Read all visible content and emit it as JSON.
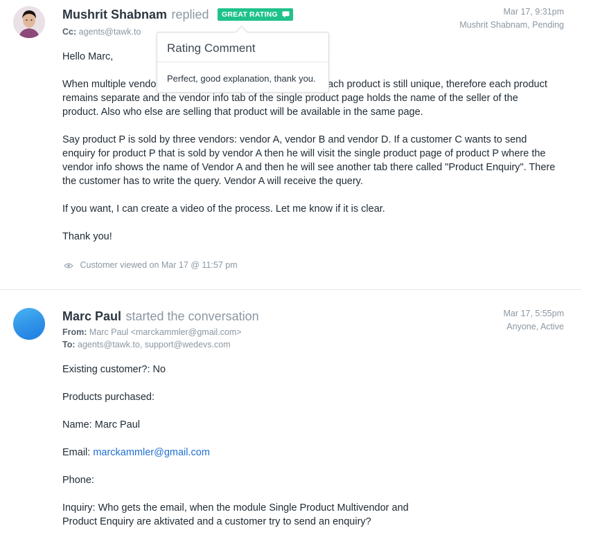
{
  "thread1": {
    "author": "Mushrit Shabnam",
    "action": "replied",
    "badge": "GREAT RATING",
    "badge_color": "#1fc28a",
    "badge_icon": "chat-bubble-icon",
    "date": "Mar 17, 9:31pm",
    "status": "Mushrit Shabnam, Pending",
    "cc_label": "Cc:",
    "cc_value": "agents@tawk.to",
    "paragraphs": [
      "Hello Marc,",
      "When multiple vendors sell the same product, the URL for each product is still unique, therefore each product remains separate and the vendor info tab of the single product page holds the name of the seller of the product. Also who else are selling that product will be available in the same page.",
      "Say product P is sold by three vendors: vendor A, vendor B and vendor D. If a customer C wants to send enquiry for product P that is sold by vendor A then he will visit the single product page of product P where the vendor info shows the name of Vendor A and then he will see another tab there called \"Product Enquiry\". There the customer has to write the query. Vendor A will receive the query.",
      "If you want, I can create a video of the process. Let me know if it is clear.",
      "Thank you!"
    ],
    "viewed": "Customer viewed on Mar 17 @ 11:57 pm",
    "viewed_icon": "eye-icon"
  },
  "popover": {
    "title": "Rating Comment",
    "text": "Perfect, good explanation, thank you."
  },
  "thread2": {
    "author": "Marc Paul",
    "action": "started the conversation",
    "date": "Mar 17, 5:55pm",
    "status": "Anyone, Active",
    "from_label": "From:",
    "from_value": "Marc Paul <marckammler@gmail.com>",
    "to_label": "To:",
    "to_value": "agents@tawk.to, support@wedevs.com",
    "lines": {
      "existing": "Existing customer?: No",
      "products": "Products purchased:",
      "name": "Name: Marc Paul",
      "email_label": "Email:",
      "email": "marckammler@gmail.com",
      "phone": "Phone:",
      "inquiry": "Inquiry: Who gets the email, when the module Single Product Multivendor and Product Enquiry are aktivated and a customer try to send an enquiry?"
    },
    "link_color": "#1f6fd1"
  }
}
